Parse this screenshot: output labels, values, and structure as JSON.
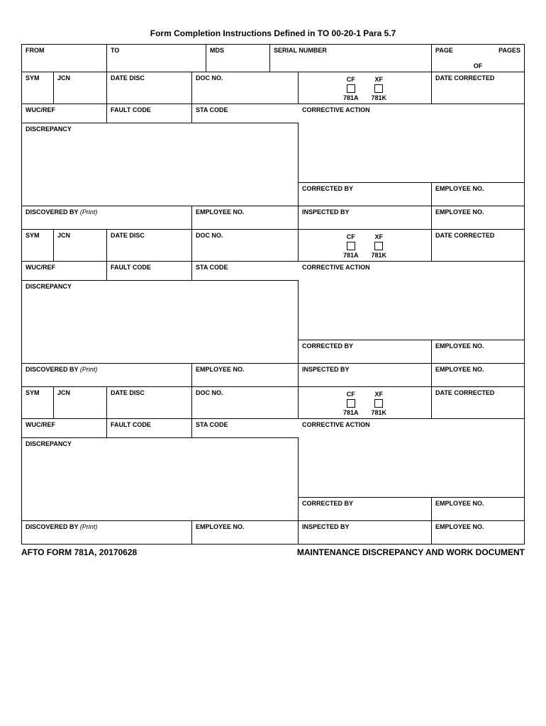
{
  "title": "Form Completion Instructions Defined in TO 00-20-1 Para 5.7",
  "header": {
    "from": "FROM",
    "to": "TO",
    "mds": "MDS",
    "serial": "SERIAL NUMBER",
    "page": "PAGE",
    "pages": "PAGES",
    "of": "OF"
  },
  "labels": {
    "sym": "SYM",
    "jcn": "JCN",
    "date_disc": "DATE DISC",
    "doc_no": "DOC NO.",
    "cf": "CF",
    "xf": "XF",
    "cf_sub": "781A",
    "xf_sub": "781K",
    "date_corrected": "DATE CORRECTED",
    "wuc_ref": "WUC/REF",
    "fault_code": "FAULT CODE",
    "sta_code": "STA CODE",
    "corrective_action": "CORRECTIVE ACTION",
    "discrepancy": "DISCREPANCY",
    "corrected_by": "CORRECTED BY",
    "employee_no": "EMPLOYEE NO.",
    "discovered_by": "DISCOVERED BY",
    "print": "(Print)",
    "inspected_by": "INSPECTED BY"
  },
  "footer": {
    "left": "AFTO FORM 781A, 20170628",
    "right": "MAINTENANCE DISCREPANCY AND WORK DOCUMENT"
  }
}
